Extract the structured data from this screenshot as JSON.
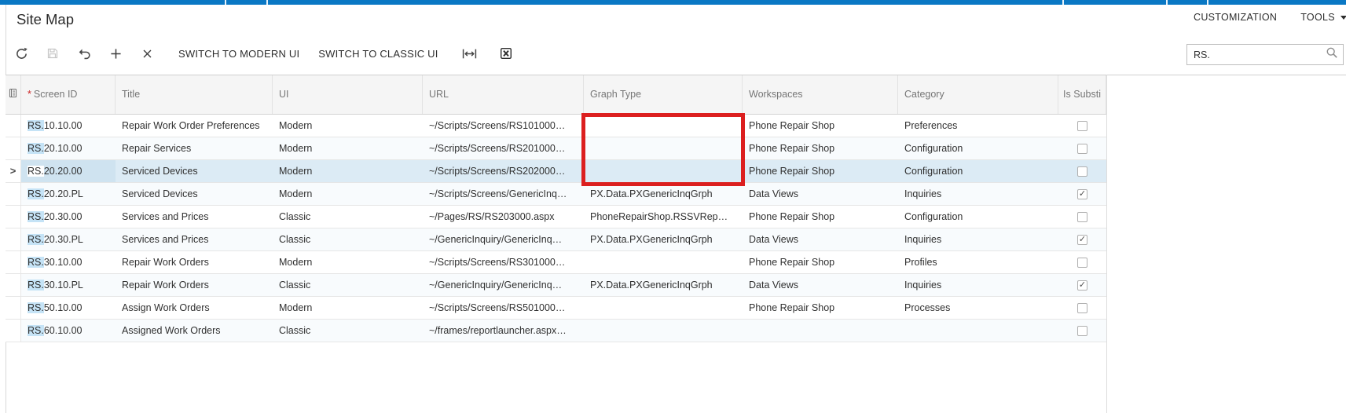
{
  "colors": {
    "topbar_blue": "#0a78c4",
    "annotation_red": "#dc1f1f",
    "selected_row": "#dcebf5",
    "search_match_highlight": "#c5e3f6"
  },
  "header": {
    "title": "Site Map",
    "links": {
      "customization": "CUSTOMIZATION",
      "tools": "TOOLS"
    }
  },
  "toolbar": {
    "switch_modern_label": "SWITCH TO MODERN UI",
    "switch_classic_label": "SWITCH TO CLASSIC UI",
    "search_value": "RS."
  },
  "icons": [
    "refresh-icon",
    "save-icon",
    "undo-icon",
    "add-row-icon",
    "delete-row-icon",
    "fit-width-icon",
    "export-excel-icon",
    "search-icon",
    "grid-settings-icon",
    "chevron-down-icon",
    "row-selector-icon",
    "checkbox"
  ],
  "grid": {
    "required_marker": "*",
    "selected_screen_id": "RS.20.20.00",
    "columns": [
      {
        "label": "Screen ID",
        "required": true
      },
      {
        "label": "Title"
      },
      {
        "label": "UI"
      },
      {
        "label": "URL"
      },
      {
        "label": "Graph Type"
      },
      {
        "label": "Workspaces"
      },
      {
        "label": "Category"
      },
      {
        "label": "Is Substi"
      }
    ],
    "rows": [
      {
        "screen_id_match": "RS.",
        "screen_id_rest": "10.10.00",
        "title": "Repair Work Order Preferences",
        "ui": "Modern",
        "url": "~/Scripts/Screens/RS101000…",
        "graph_type": "",
        "workspaces": "Phone Repair Shop",
        "category": "Preferences",
        "is_substituted": false
      },
      {
        "screen_id_match": "RS.",
        "screen_id_rest": "20.10.00",
        "title": "Repair Services",
        "ui": "Modern",
        "url": "~/Scripts/Screens/RS201000…",
        "graph_type": "",
        "workspaces": "Phone Repair Shop",
        "category": "Configuration",
        "is_substituted": false
      },
      {
        "screen_id_match": "RS.",
        "screen_id_rest": "20.20.00",
        "title": "Serviced Devices",
        "ui": "Modern",
        "url": "~/Scripts/Screens/RS202000…",
        "graph_type": "",
        "workspaces": "Phone Repair Shop",
        "category": "Configuration",
        "is_substituted": false
      },
      {
        "screen_id_match": "RS.",
        "screen_id_rest": "20.20.PL",
        "title": "Serviced Devices",
        "ui": "Modern",
        "url": "~/Scripts/Screens/GenericInq…",
        "graph_type": "PX.Data.PXGenericInqGrph",
        "workspaces": "Data Views",
        "category": "Inquiries",
        "is_substituted": true
      },
      {
        "screen_id_match": "RS.",
        "screen_id_rest": "20.30.00",
        "title": "Services and Prices",
        "ui": "Classic",
        "url": "~/Pages/RS/RS203000.aspx",
        "graph_type": "PhoneRepairShop.RSSVRep…",
        "workspaces": "Phone Repair Shop",
        "category": "Configuration",
        "is_substituted": false
      },
      {
        "screen_id_match": "RS.",
        "screen_id_rest": "20.30.PL",
        "title": "Services and Prices",
        "ui": "Classic",
        "url": "~/GenericInquiry/GenericInq…",
        "graph_type": "PX.Data.PXGenericInqGrph",
        "workspaces": "Data Views",
        "category": "Inquiries",
        "is_substituted": true
      },
      {
        "screen_id_match": "RS.",
        "screen_id_rest": "30.10.00",
        "title": "Repair Work Orders",
        "ui": "Modern",
        "url": "~/Scripts/Screens/RS301000…",
        "graph_type": "",
        "workspaces": "Phone Repair Shop",
        "category": "Profiles",
        "is_substituted": false
      },
      {
        "screen_id_match": "RS.",
        "screen_id_rest": "30.10.PL",
        "title": "Repair Work Orders",
        "ui": "Classic",
        "url": "~/GenericInquiry/GenericInq…",
        "graph_type": "PX.Data.PXGenericInqGrph",
        "workspaces": "Data Views",
        "category": "Inquiries",
        "is_substituted": true
      },
      {
        "screen_id_match": "RS.",
        "screen_id_rest": "50.10.00",
        "title": "Assign Work Orders",
        "ui": "Modern",
        "url": "~/Scripts/Screens/RS501000…",
        "graph_type": "",
        "workspaces": "Phone Repair Shop",
        "category": "Processes",
        "is_substituted": false
      },
      {
        "screen_id_match": "RS.",
        "screen_id_rest": "60.10.00",
        "title": "Assigned Work Orders",
        "ui": "Classic",
        "url": "~/frames/reportlauncher.aspx…",
        "graph_type": "",
        "workspaces": "",
        "category": "",
        "is_substituted": false
      }
    ]
  }
}
